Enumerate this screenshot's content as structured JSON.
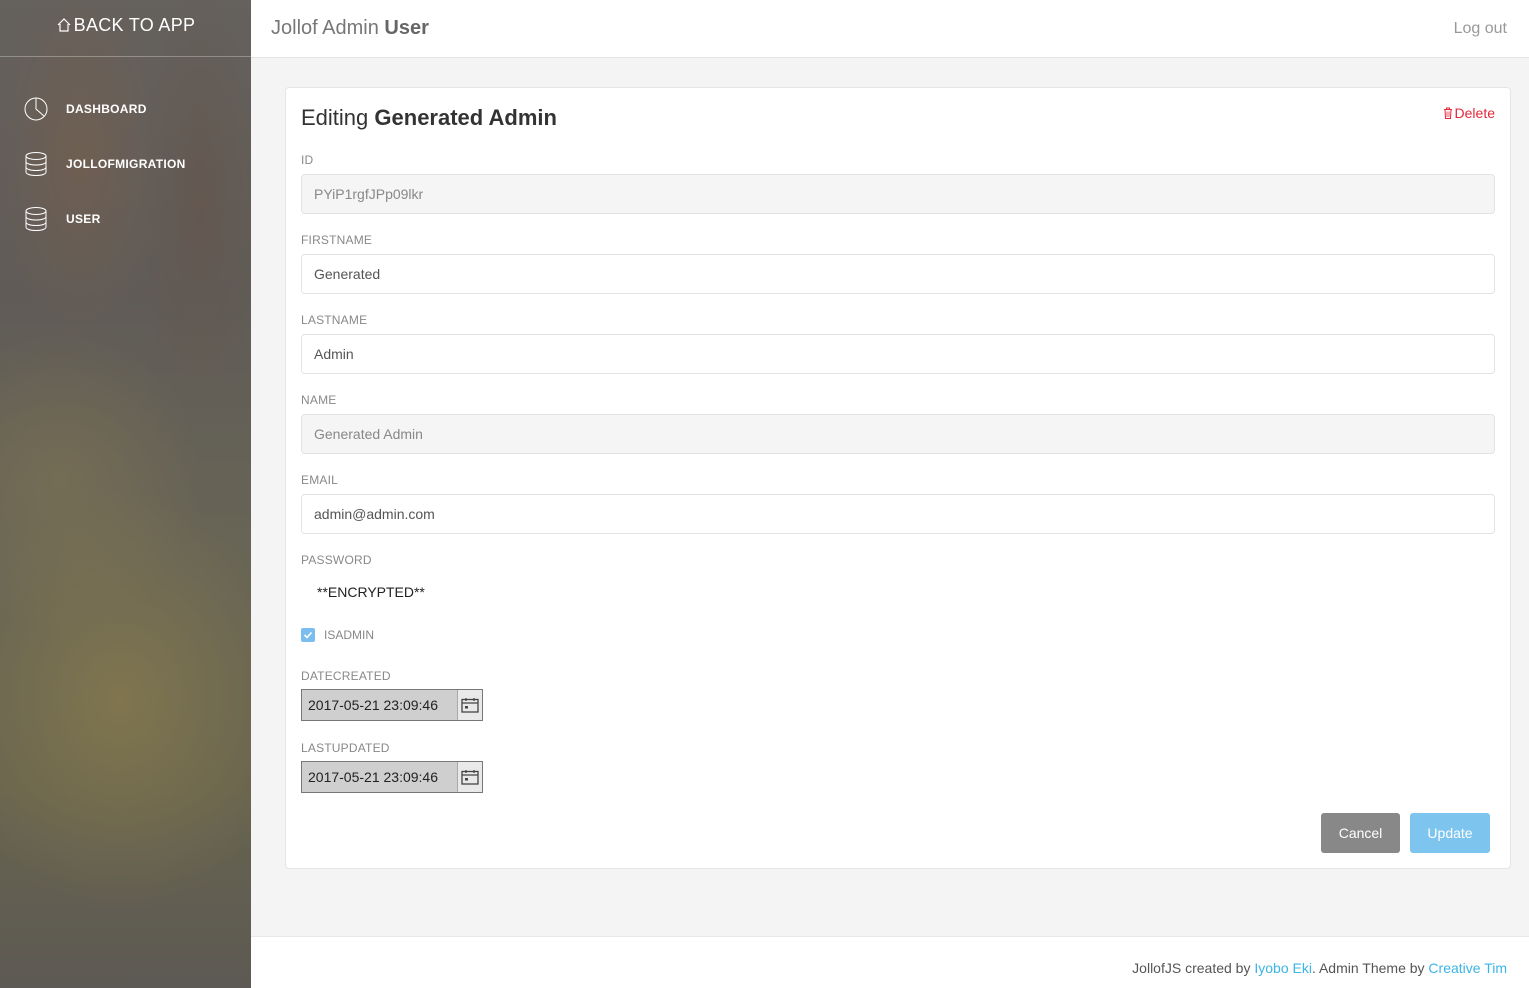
{
  "sidebar": {
    "back_label": "BACK TO APP",
    "items": [
      {
        "label": "DASHBOARD",
        "icon": "pie-chart-icon"
      },
      {
        "label": "JOLLOFMIGRATION",
        "icon": "database-icon"
      },
      {
        "label": "USER",
        "icon": "database-icon"
      }
    ]
  },
  "header": {
    "brand_prefix": "Jollof Admin",
    "brand_model": "User",
    "logout": "Log out"
  },
  "form": {
    "title_prefix": "Editing",
    "title_name": "Generated Admin",
    "delete_label": "Delete",
    "fields": {
      "id": {
        "label": "ID",
        "value": "PYiP1rgfJPp09lkr"
      },
      "firstname": {
        "label": "FIRSTNAME",
        "value": "Generated"
      },
      "lastname": {
        "label": "LASTNAME",
        "value": "Admin"
      },
      "name": {
        "label": "NAME",
        "value": "Generated Admin"
      },
      "email": {
        "label": "EMAIL",
        "value": "admin@admin.com"
      },
      "password": {
        "label": "PASSWORD",
        "value": "**ENCRYPTED**"
      },
      "isadmin": {
        "label": "ISADMIN",
        "checked": true
      },
      "datecreated": {
        "label": "DATECREATED",
        "value": "2017-05-21 23:09:46"
      },
      "lastupdated": {
        "label": "LASTUPDATED",
        "value": "2017-05-21 23:09:46"
      }
    },
    "cancel_label": "Cancel",
    "update_label": "Update"
  },
  "footer": {
    "text1": "JollofJS created by",
    "author": "Iyobo Eki",
    "text2": ". Admin Theme by",
    "theme_author": "Creative Tim"
  },
  "colors": {
    "accent": "#7dc4ee",
    "delete": "#e3293a",
    "link": "#3bb4e6"
  }
}
